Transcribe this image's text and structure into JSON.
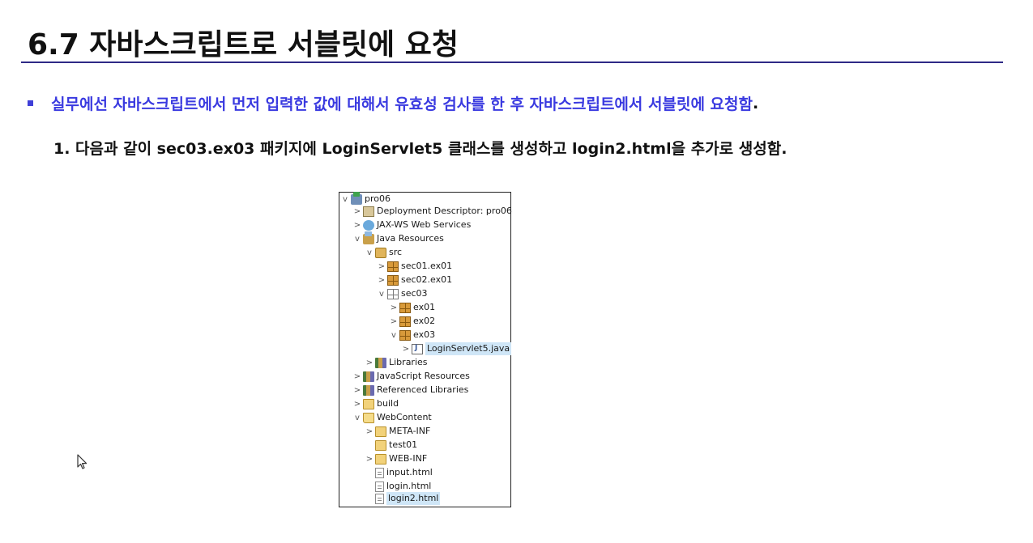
{
  "slide": {
    "title": "6.7 자바스크립트로 서블릿에 요청",
    "bullet_text": "실무에선 자바스크립트에서 먼저 입력한 값에 대해서 유효성 검사를 한 후 자바스크립트에서 서블릿에 요청함",
    "bullet_end": ".",
    "step_text": "1. 다음과 같이 sec03.ex03 패키지에 LoginServlet5 클래스를 생성하고 login2.html을 추가로 생성함."
  },
  "colors": {
    "title_rule": "#2e2a86",
    "bullet_text": "#3a3ae0",
    "tree_selection": "#cfe6f7"
  },
  "tree": {
    "items": [
      {
        "label": "pro06",
        "chevron": "v",
        "icon": "project-icon"
      },
      {
        "label": "Deployment Descriptor: pro06",
        "chevron": ">",
        "icon": "deployment-descriptor-icon"
      },
      {
        "label": "JAX-WS Web Services",
        "chevron": ">",
        "icon": "web-services-icon"
      },
      {
        "label": "Java Resources",
        "chevron": "v",
        "icon": "java-resources-icon"
      },
      {
        "label": "src",
        "chevron": "v",
        "icon": "source-folder-icon"
      },
      {
        "label": "sec01.ex01",
        "chevron": ">",
        "icon": "package-icon"
      },
      {
        "label": "sec02.ex01",
        "chevron": ">",
        "icon": "package-icon"
      },
      {
        "label": "sec03",
        "chevron": "v",
        "icon": "empty-package-icon"
      },
      {
        "label": "ex01",
        "chevron": ">",
        "icon": "package-icon"
      },
      {
        "label": "ex02",
        "chevron": ">",
        "icon": "package-icon"
      },
      {
        "label": "ex03",
        "chevron": "v",
        "icon": "package-icon"
      },
      {
        "label": "LoginServlet5.java",
        "chevron": ">",
        "icon": "java-file-icon",
        "selected": true
      },
      {
        "label": "Libraries",
        "chevron": ">",
        "icon": "library-icon"
      },
      {
        "label": "JavaScript Resources",
        "chevron": ">",
        "icon": "library-icon"
      },
      {
        "label": "Referenced Libraries",
        "chevron": ">",
        "icon": "library-icon"
      },
      {
        "label": "build",
        "chevron": ">",
        "icon": "folder-icon"
      },
      {
        "label": "WebContent",
        "chevron": "v",
        "icon": "open-folder-icon"
      },
      {
        "label": "META-INF",
        "chevron": ">",
        "icon": "folder-icon"
      },
      {
        "label": "test01",
        "chevron": "",
        "icon": "folder-icon"
      },
      {
        "label": "WEB-INF",
        "chevron": ">",
        "icon": "folder-icon"
      },
      {
        "label": "input.html",
        "chevron": "",
        "icon": "html-file-icon"
      },
      {
        "label": "login.html",
        "chevron": "",
        "icon": "html-file-icon"
      },
      {
        "label": "login2.html",
        "chevron": "",
        "icon": "html-file-icon",
        "selected": true
      }
    ]
  }
}
